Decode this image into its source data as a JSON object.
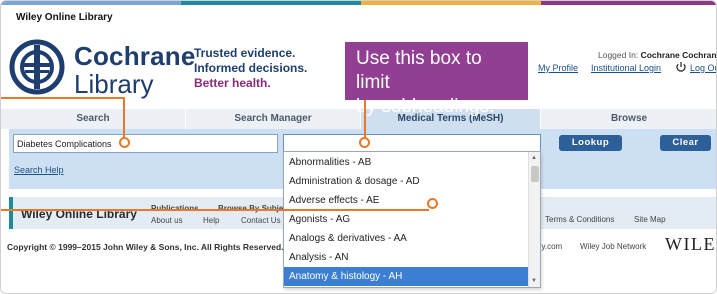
{
  "header": {
    "site_title": "Wiley Online Library",
    "brand_line1": "Cochrane",
    "brand_line2": "Library",
    "tagline": [
      "Trusted evidence.",
      "Informed decisions.",
      "Better health."
    ],
    "my_profile": "My Profile",
    "logged_in_prefix": "Logged In:",
    "logged_in_user": "Cochrane Cochrane",
    "institutional_login": "Institutional Login",
    "log_out": "Log Out",
    "power_icon": "power-icon"
  },
  "callout": {
    "text_line1": "Use this box to limit",
    "text_line2": "by subheadings."
  },
  "tabs": [
    {
      "label": "Search",
      "active": false
    },
    {
      "label": "Search Manager",
      "active": false
    },
    {
      "label": "Medical Terms (MeSH)",
      "active": true
    },
    {
      "label": "Browse",
      "active": false
    }
  ],
  "search": {
    "term_value": "Diabetes Complications",
    "subheading_value": "",
    "lookup_label": "Lookup",
    "clear_label": "Clear",
    "help_label": "Search Help"
  },
  "dropdown": {
    "options": [
      "Abnormalities - AB",
      "Administration & dosage - AD",
      "Adverse effects - AE",
      "Agonists - AG",
      "Analogs & derivatives - AA",
      "Analysis - AN",
      "Anatomy & histology - AH"
    ],
    "selected_index": 6
  },
  "footer": {
    "logo_text": "Wiley Online Library",
    "publications": "Publications",
    "browse_by_subject": "Browse By Subje",
    "about_us": "About us",
    "help": "Help",
    "contact_us": "Contact Us",
    "terms": "Terms & Conditions",
    "site_map": "Site Map",
    "copyright": "Copyright © 1999–2015 John Wiley & Sons, Inc. All Rights Reserved.",
    "ley_com": "ey.com",
    "wiley_job_network": "Wiley Job Network",
    "wiley_wordmark": "WILEY"
  },
  "colors": {
    "accent_orange": "#e8782a",
    "callout_purple": "#913e93",
    "brand_navy": "#1d3e6e",
    "selected_blue": "#3c7fd2",
    "button_blue": "#2d5f99"
  }
}
